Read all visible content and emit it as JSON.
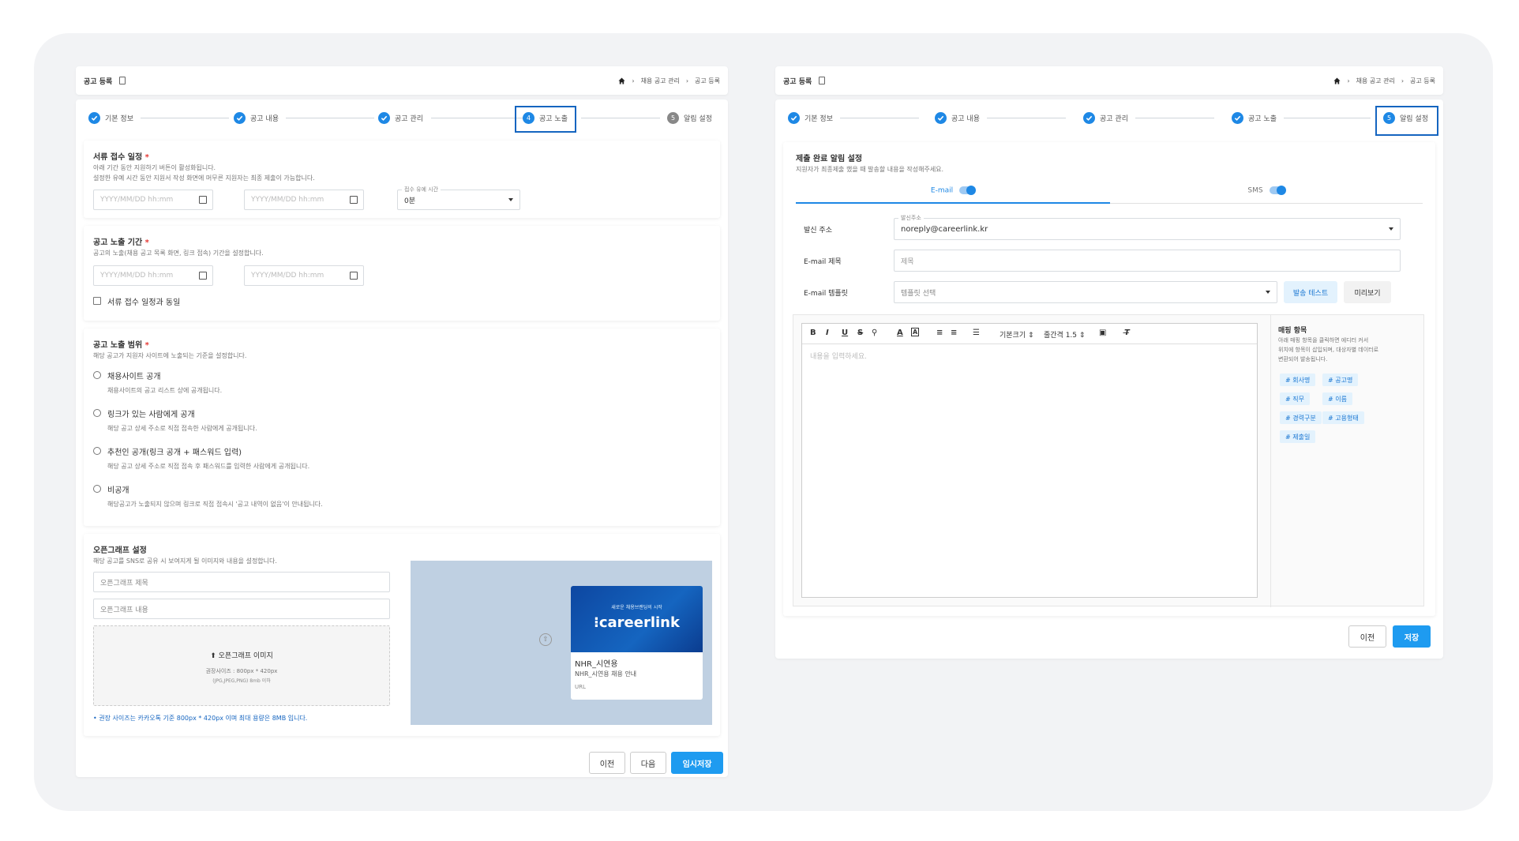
{
  "left": {
    "title": "공고 등록",
    "breadcrumb": [
      "채용 공고 관리",
      "공고 등록"
    ],
    "steps": [
      "기본 정보",
      "공고 내용",
      "공고 관리",
      "공고 노출",
      "알림 설정"
    ],
    "step_active_num": "4",
    "step_pending_num": "5",
    "doc": {
      "title": "서류 접수 일정",
      "desc1": "아래 기간 동안 지원하기 버튼이 활성화됩니다.",
      "desc2": "설정한 유예 시간 동안 지원서 작성 화면에 머무른 지원자는 최종 제출이 가능합니다.",
      "start_ph": "YYYY/MM/DD hh:mm",
      "end_ph": "YYYY/MM/DD hh:mm",
      "grace_label": "접수 유예 시간",
      "grace_value": "0분"
    },
    "expo": {
      "title": "공고 노출 기간",
      "desc": "공고의 노출(채용 공고 목록 화면, 링크 접속) 기간을 설정합니다.",
      "start_ph": "YYYY/MM/DD hh:mm",
      "end_ph": "YYYY/MM/DD hh:mm",
      "same_label": "서류 접수 일정과 동일"
    },
    "range": {
      "title": "공고 노출 범위",
      "desc": "해당 공고가 지원자 사이트에 노출되는 기준을 설정합니다.",
      "options": [
        {
          "label": "채용사이트 공개",
          "desc": "채용사이트의 공고 리스트 상에 공개됩니다."
        },
        {
          "label": "링크가 있는 사람에게 공개",
          "desc": "해당 공고 상세 주소로 직접 접속한 사람에게 공개됩니다."
        },
        {
          "label": "추천인 공개(링크 공개 + 패스워드 입력)",
          "desc": "해당 공고 상세 주소로 직접 접속 후 패스워드를 입력한 사람에게 공개됩니다."
        },
        {
          "label": "비공개",
          "desc": "해당공고가 노출되지 않으며 링크로 직접 접속시 '공고 내역이 없음'이 안내됩니다."
        }
      ]
    },
    "og": {
      "title": "오픈그래프 설정",
      "desc": "해당 공고를 SNS로 공유 시 보여지게 될 이미지와 내용을 설정합니다.",
      "title_ph": "오픈그래프 제목",
      "content_ph": "오픈그래프 내용",
      "upload_label": "오픈그래프 이미지",
      "upload_size": "권장사이즈 : 800px * 420px",
      "upload_types": "(JPG,JPEG,PNG) 8mb 이하",
      "note": "권장 사이즈는 카카오톡 기준 800px * 420px 이며 최대 용량은 8MB 입니다.",
      "card_banner_top": "새로운 채용브랜딩의 시작",
      "card_brand": "careerlink",
      "card_title": "NHR_시연용",
      "card_sub": "NHR_시연용 채용 안내",
      "card_url": "URL"
    },
    "buttons": {
      "prev": "이전",
      "next": "다음",
      "temp_save": "임시저장"
    }
  },
  "right": {
    "title": "공고 등록",
    "breadcrumb": [
      "채용 공고 관리",
      "공고 등록"
    ],
    "steps": [
      "기본 정보",
      "공고 내용",
      "공고 관리",
      "공고 노출",
      "알림 설정"
    ],
    "step_active_num": "5",
    "notice": {
      "title": "제출 완료 알림 설정",
      "desc": "지원자가 최종제출 했을 때 발송할 내용을 작성해주세요."
    },
    "tabs": [
      {
        "label": "E-mail"
      },
      {
        "label": "SMS"
      }
    ],
    "sender_label": "발신 주소",
    "sender_float": "발신주소",
    "sender_value": "noreply@careerlink.kr",
    "subject_label": "E-mail 제목",
    "subject_ph": "제목",
    "template_label": "E-mail 템플릿",
    "template_ph": "템플릿 선택",
    "send_test": "발송 테스트",
    "preview": "미리보기",
    "toolbar": {
      "bold": "B",
      "italic": "I",
      "underline": "U",
      "strike": "S",
      "size": "기본크기",
      "spacing": "줄간격 1.5"
    },
    "editor_ph": "내용을 입력하세요.",
    "mapping": {
      "title": "매핑 항목",
      "desc1": "아래 매핑 항목을 클릭하면 에디터 커서",
      "desc2": "위치에 항목이 삽입되며, 대상자별 데이터로",
      "desc3": "변환되어 발송됩니다.",
      "tags": [
        "# 회사명",
        "# 공고명",
        "# 직무",
        "# 이름",
        "# 경력구분",
        "# 고용형태",
        "# 제출일"
      ]
    },
    "buttons": {
      "prev": "이전",
      "save": "저장"
    }
  },
  "colors": {
    "primary": "#1e88e5",
    "button": "#1e9bf0",
    "highlight_box": "#1565c0"
  }
}
